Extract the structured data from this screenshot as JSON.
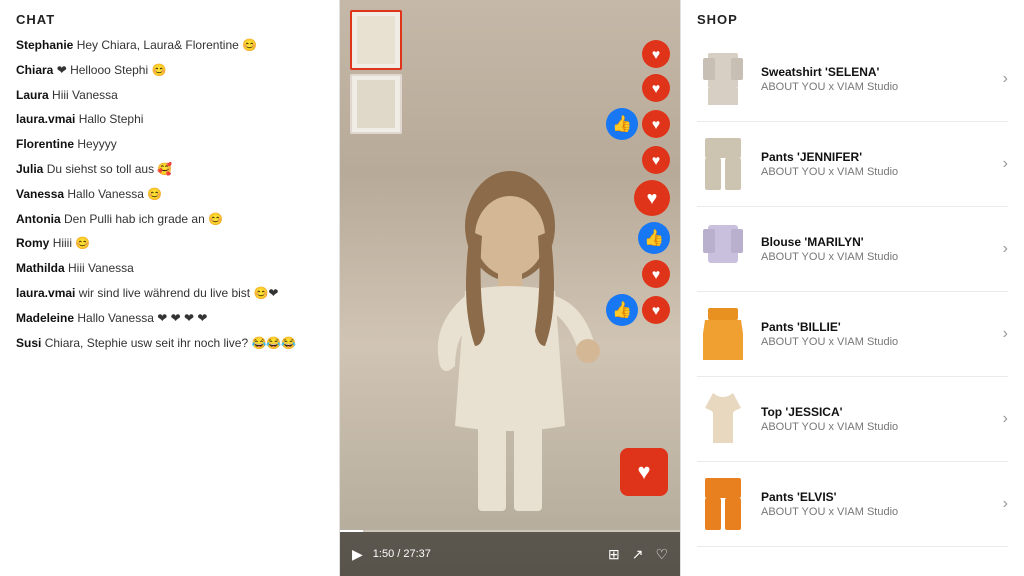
{
  "chat": {
    "title": "CHAT",
    "messages": [
      {
        "username": "Stephanie",
        "text": "Hey Chiara, Laura& Florentine 😊"
      },
      {
        "username": "Chiara",
        "text": "❤ Hellooo Stephi 😊"
      },
      {
        "username": "Laura",
        "text": "Hiii Vanessa"
      },
      {
        "username": "laura.vmai",
        "text": "Hallo Stephi"
      },
      {
        "username": "Florentine",
        "text": "Heyyyy"
      },
      {
        "username": "Julia",
        "text": "Du siehst so toll aus 🥰"
      },
      {
        "username": "Vanessa",
        "text": "Hallo Vanessa 😊"
      },
      {
        "username": "Antonia",
        "text": "Den Pulli hab ich grade an 😊"
      },
      {
        "username": "Romy",
        "text": "Hiiii 😊"
      },
      {
        "username": "Mathilda",
        "text": "Hiii Vanessa"
      },
      {
        "username": "laura.vmai",
        "text": "wir sind live während du live bist 😊❤"
      },
      {
        "username": "Madeleine",
        "text": "Hallo Vanessa ❤ ❤ ❤ ❤"
      },
      {
        "username": "Susi",
        "text": "Chiara, Stephie usw seit ihr noch live? 😂😂😂"
      }
    ]
  },
  "video": {
    "current_time": "1:50",
    "total_time": "27:37",
    "play_icon": "▶",
    "grid_icon": "⊞",
    "share_icon": "↗",
    "heart_icon": "♡"
  },
  "shop": {
    "title": "SHOP",
    "items": [
      {
        "name": "Sweatshirt 'SELENA'",
        "brand": "ABOUT YOU x VIAM Studio",
        "color": "sweatshirt",
        "type": "top"
      },
      {
        "name": "Pants 'JENNIFER'",
        "brand": "ABOUT YOU x VIAM Studio",
        "color": "pants-beige",
        "type": "pants"
      },
      {
        "name": "Blouse 'MARILYN'",
        "brand": "ABOUT YOU x VIAM Studio",
        "color": "blouse-purple",
        "type": "blouse"
      },
      {
        "name": "Pants 'BILLIE'",
        "brand": "ABOUT YOU x VIAM Studio",
        "color": "pants-orange",
        "type": "skirt"
      },
      {
        "name": "Top 'JESSICA'",
        "brand": "ABOUT YOU x VIAM Studio",
        "color": "top-beige",
        "type": "top2"
      },
      {
        "name": "Pants 'ELVIS'",
        "brand": "ABOUT YOU x VIAM Studio",
        "color": "pants-orange2",
        "type": "pants2"
      }
    ]
  }
}
